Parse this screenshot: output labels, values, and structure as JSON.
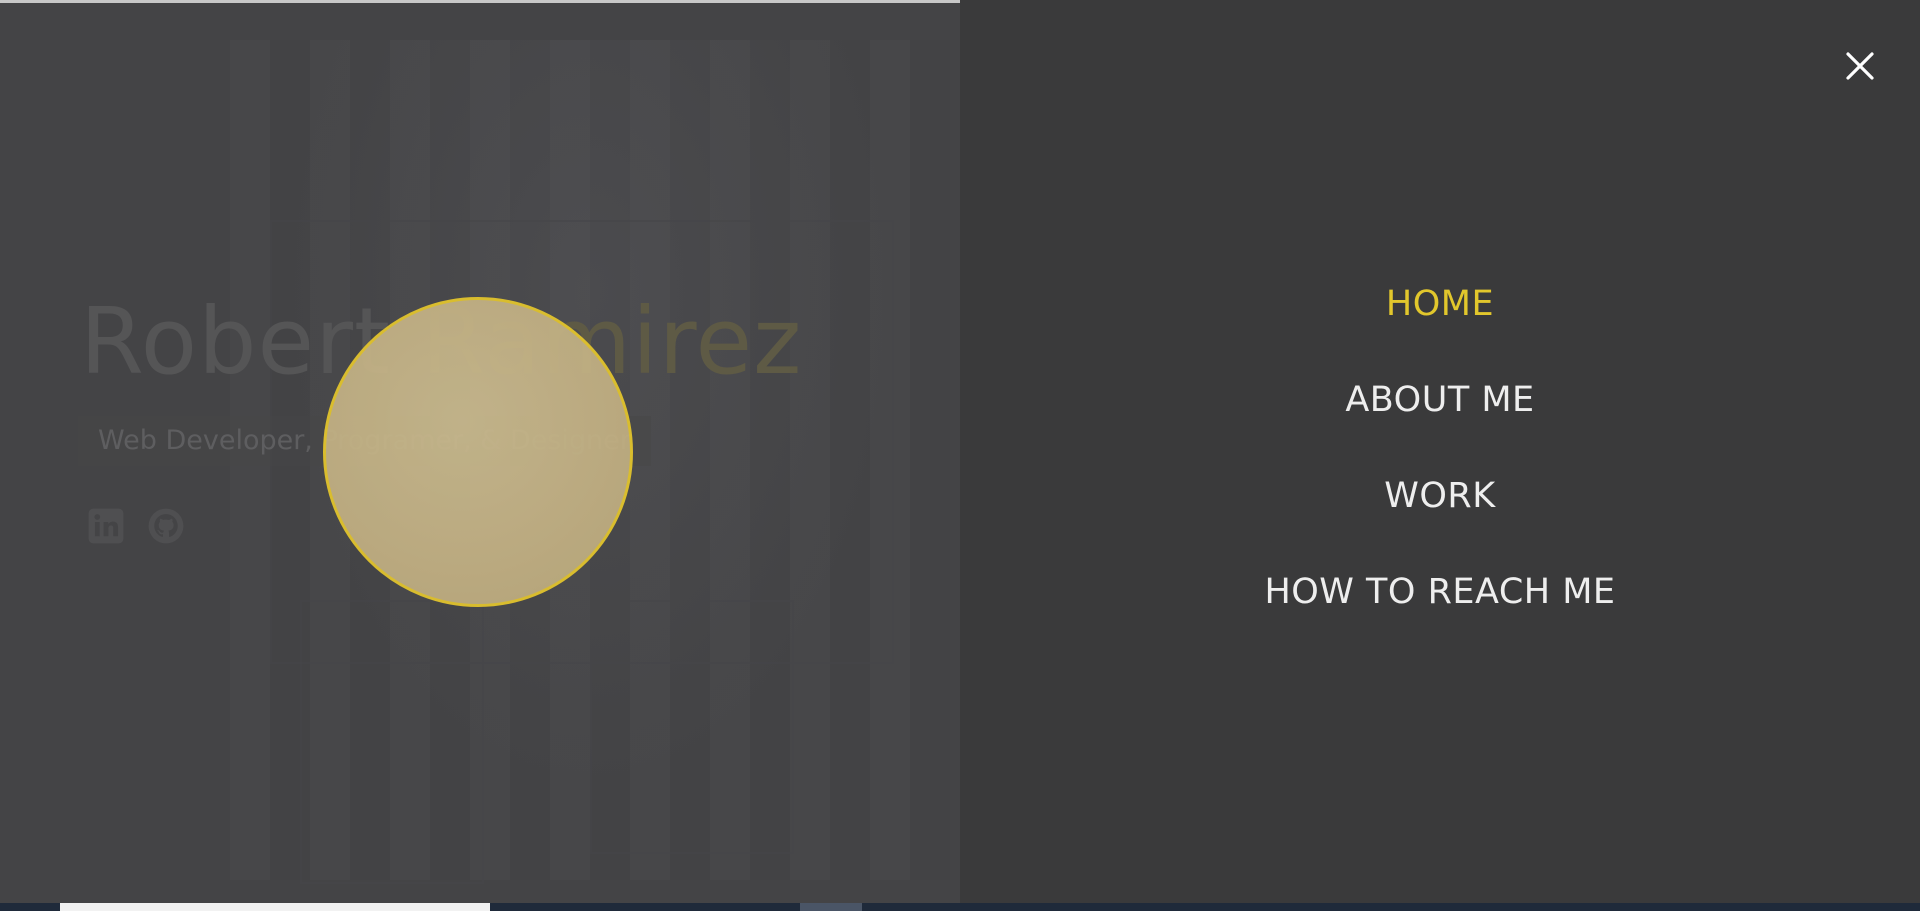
{
  "hero": {
    "name_first": "Robert",
    "name_last": "Ramirez",
    "subtitle": "Web Developer, Programer, & Designer",
    "socials": [
      {
        "icon": "linkedin-icon"
      },
      {
        "icon": "github-icon"
      }
    ]
  },
  "menu": {
    "close_icon": "close-icon",
    "items": [
      {
        "label": "HOME",
        "active": true
      },
      {
        "label": "ABOUT ME",
        "active": false
      },
      {
        "label": "WORK",
        "active": false
      },
      {
        "label": "HOW TO REACH ME",
        "active": false
      }
    ]
  },
  "colors": {
    "accent": "#e2c72c",
    "overlay": "#3a3a3b",
    "menu_text": "#eeeeee"
  }
}
